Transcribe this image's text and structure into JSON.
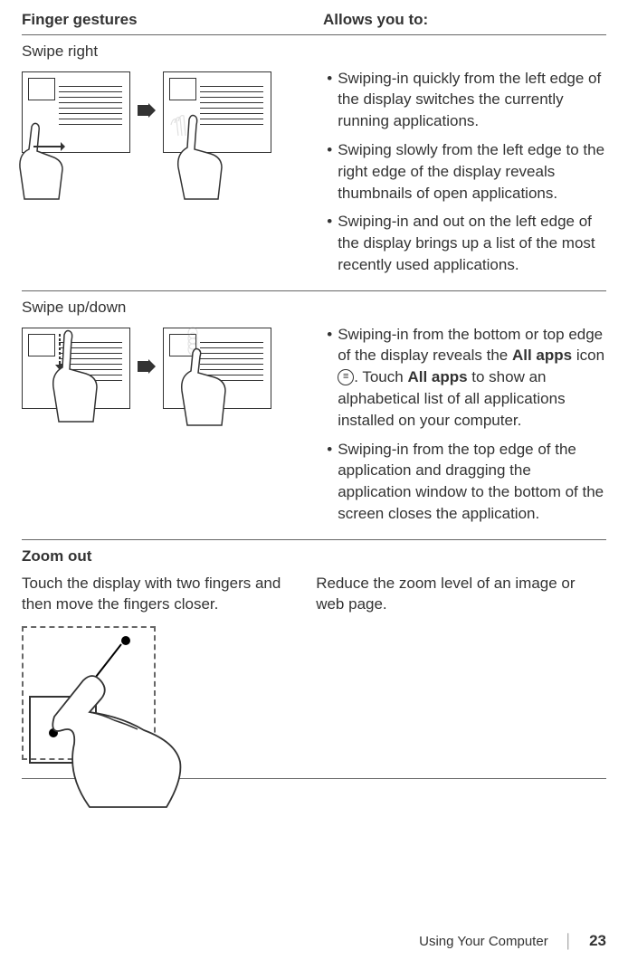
{
  "header": {
    "left": "Finger gestures",
    "right": "Allows you to:"
  },
  "sections": {
    "swipe_right": {
      "title": "Swipe right",
      "items": [
        "Swiping-in quickly from the left edge of the display switches the currently running applications.",
        "Swiping slowly from the left edge to the right edge of the display reveals thumbnails of open applications.",
        "Swiping-in and out on the left edge of the display brings up a list of the most recently used applications."
      ]
    },
    "swipe_updown": {
      "title": "Swipe up/down",
      "item1_part1": "Swiping-in from the bottom or top edge of the display reveals the ",
      "item1_bold1": "All apps",
      "item1_part2": " icon ",
      "item1_part3": ". Touch ",
      "item1_bold2": "All apps",
      "item1_part4": " to show an alphabetical list of all applications installed on your computer.",
      "item2": "Swiping-in from the top edge of the application and dragging the application window to the bottom of the screen closes the application."
    },
    "zoom_out": {
      "title": "Zoom out",
      "subtext": "Touch the display with two fingers and then move the fingers closer.",
      "desc": "Reduce the zoom level of an image or web page."
    }
  },
  "footer": {
    "section": "Using Your Computer",
    "page": "23"
  }
}
